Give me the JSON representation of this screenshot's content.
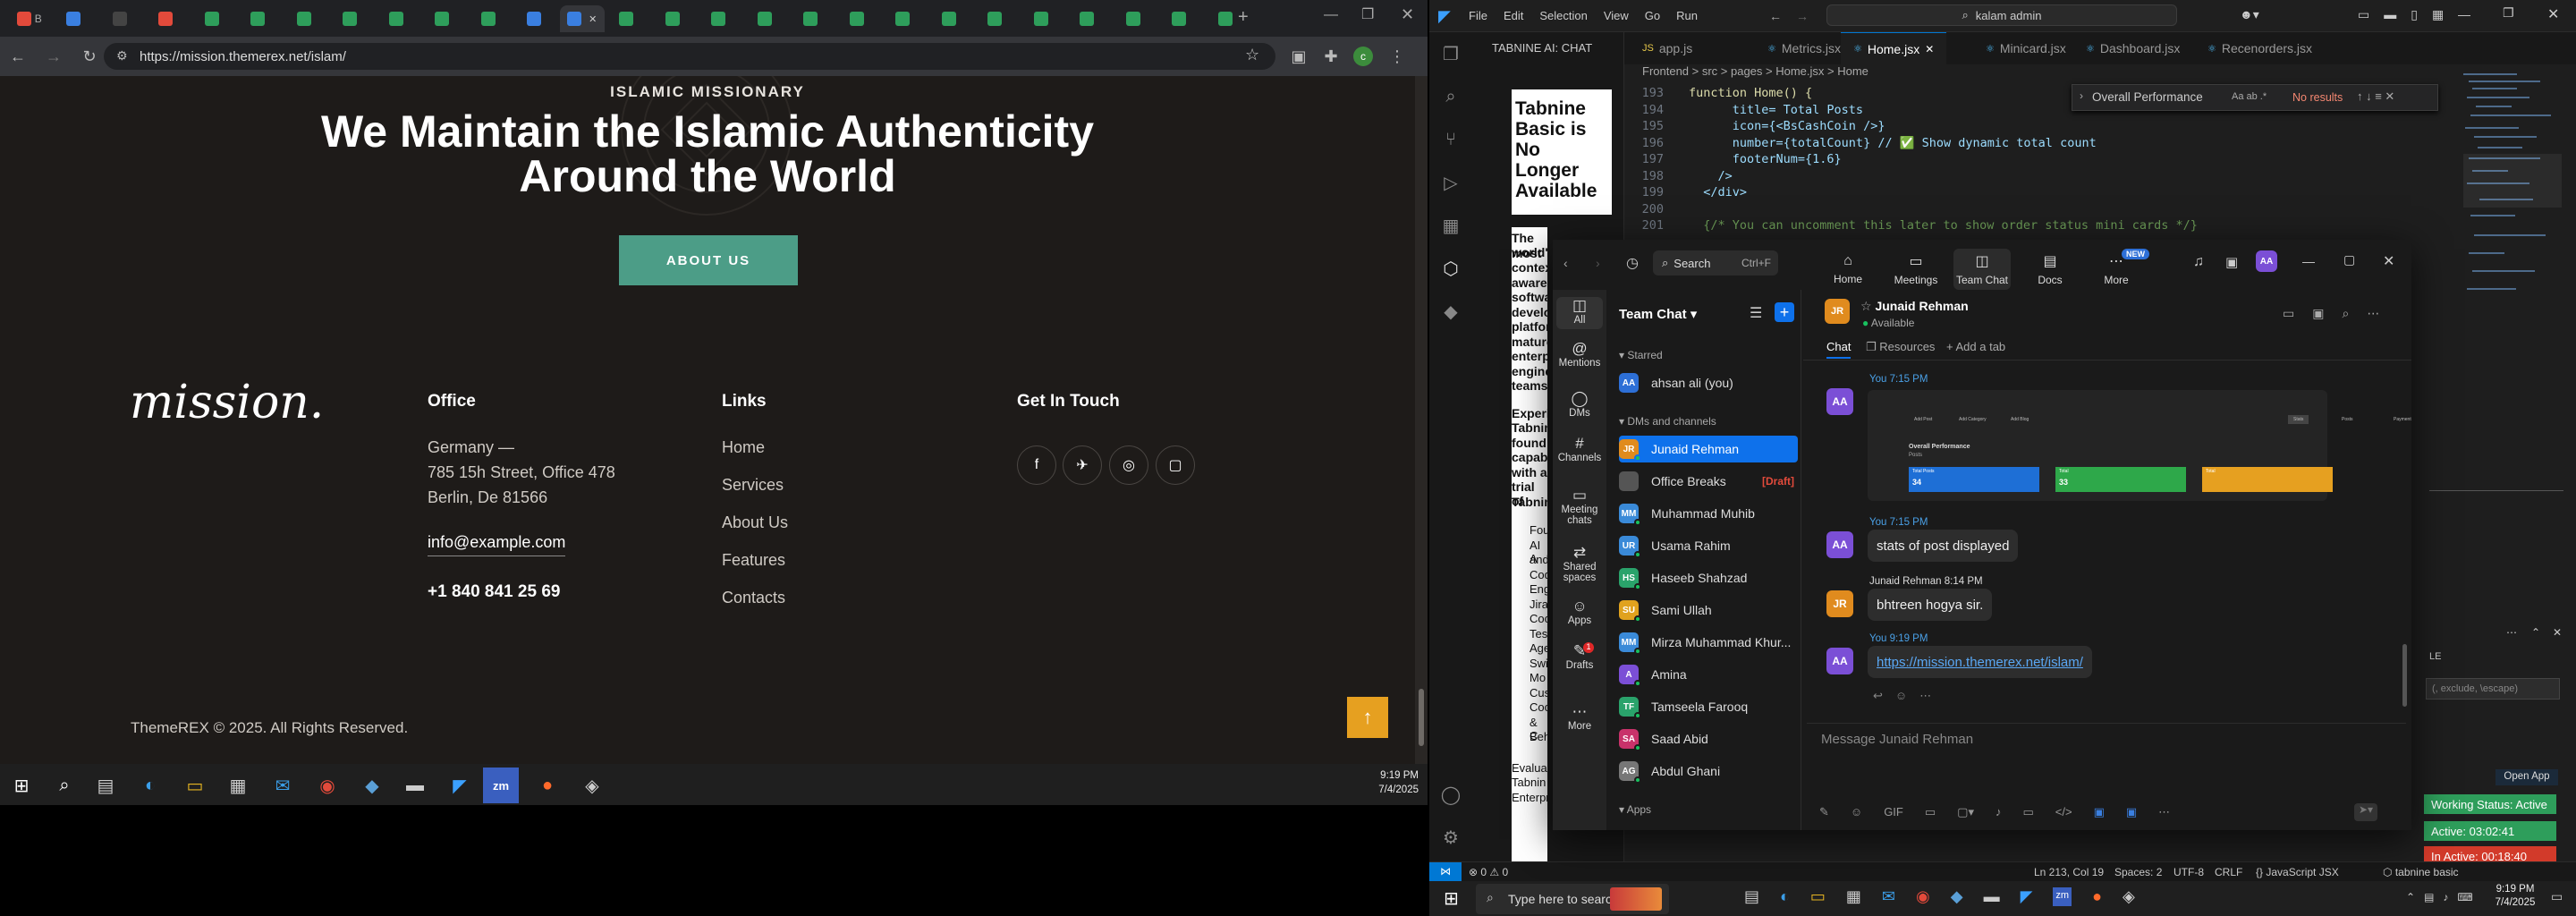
{
  "browser": {
    "tabs": [
      "B",
      "",
      "",
      "",
      "",
      "",
      "",
      "",
      "",
      "",
      "",
      "",
      "",
      "",
      "",
      "",
      "",
      "",
      "",
      "",
      "",
      "",
      "",
      "",
      "",
      "",
      ""
    ],
    "active_tab_label": "B",
    "url": "https://mission.themerex.net/islam/"
  },
  "site": {
    "kicker": "ISLAMIC MISSIONARY",
    "title_line1": "We Maintain the Islamic Authenticity",
    "title_line2": "Around the World",
    "about_button": "ABOUT US",
    "logo": "mission.",
    "office": {
      "heading": "Office",
      "line1": "Germany —",
      "line2": "785 15h Street, Office 478",
      "line3": "Berlin, De 81566",
      "email": "info@example.com",
      "phone": "+1 840 841 25 69"
    },
    "links": {
      "heading": "Links",
      "items": [
        "Home",
        "Services",
        "About Us",
        "Features",
        "Contacts"
      ]
    },
    "touch": {
      "heading": "Get In Touch"
    },
    "copyright": "ThemeREX © 2025. All Rights Reserved."
  },
  "left_taskbar": {
    "time": "9:19 PM",
    "date": "7/4/2025"
  },
  "vscode": {
    "menu": [
      "File",
      "Edit",
      "Selection",
      "View",
      "Go",
      "Run"
    ],
    "search": "kalam admin",
    "panel_title": "TABNINE AI: CHAT",
    "tabnine_title": "Tabnine Basic is No Longer Available",
    "tabnine_text": [
      "The world's",
      "most",
      "contex",
      "aware",
      "softwa",
      "develo",
      "platfor",
      "mature",
      "enterp",
      "engine",
      "teams."
    ],
    "tabnine_text2": [
      "Experi",
      "Tabnin",
      "found:",
      "capabi",
      "with a",
      "trial of",
      "Tabnin"
    ],
    "tabnine_bullets": [
      "Fou",
      "AI A",
      "and",
      "Cod",
      "Eng",
      "Jira",
      "Coc",
      "Tes",
      "Age",
      "Swi",
      "Mo",
      "Cus",
      "Coc",
      "& C",
      "Beh"
    ],
    "tabnine_footer": [
      "Evalua",
      "Tabnin",
      "Enterprise:"
    ],
    "tabs": [
      "app.js",
      "Metrics.jsx",
      "Home.jsx",
      "Minicard.jsx",
      "Dashboard.jsx",
      "Recenorders.jsx"
    ],
    "breadcrumb": "Frontend > src > pages > Home.jsx > Home",
    "code": [
      {
        "n": "193",
        "t": "function Home() {"
      },
      {
        "n": "194",
        "t": "      title= Total Posts"
      },
      {
        "n": "195",
        "t": "      icon={<BsCashCoin />}"
      },
      {
        "n": "196",
        "t": "      number={totalCount} // ✅ Show dynamic total count"
      },
      {
        "n": "197",
        "t": "      footerNum={1.6}"
      },
      {
        "n": "198",
        "t": "    />"
      },
      {
        "n": "199",
        "t": "  </div>"
      },
      {
        "n": "200",
        "t": ""
      },
      {
        "n": "201",
        "t": "  {/* You can uncomment this later to show order status mini cards */}"
      }
    ],
    "find_value": "Overall Performance",
    "find_result": "No results",
    "status": {
      "errors": "0",
      "warnings": "0",
      "position": "Ln 213, Col 19",
      "spaces": "Spaces: 2",
      "encoding": "UTF-8",
      "eol": "CRLF",
      "language": "JavaScript JSX",
      "tabnine": "tabnine basic"
    },
    "side_hint": "(, exclude, \\escape)",
    "open_app": "Open App",
    "timers": {
      "working": "Working Status: Active",
      "active": "Active: 03:02:41",
      "inactive": "In Active: 00:18:40"
    },
    "side_label": "LE"
  },
  "zoom": {
    "nav": [
      "Home",
      "Meetings",
      "Team Chat",
      "Docs",
      "More"
    ],
    "new_badge": "NEW",
    "search": "Search",
    "shortcut": "Ctrl+F",
    "rail": [
      "All",
      "Mentions",
      "DMs",
      "Channels",
      "Meeting chats",
      "Shared spaces",
      "Apps",
      "Drafts",
      "More"
    ],
    "drafts_badge": "1",
    "list_title": "Team Chat",
    "starred": "Starred",
    "dms_header": "DMs and channels",
    "apps_header": "Apps",
    "contacts": [
      {
        "initials": "AA",
        "name": "ahsan ali (you)",
        "color": "#2d6fd6"
      },
      {
        "initials": "JR",
        "name": "Junaid Rehman",
        "color": "#e08b1e"
      },
      {
        "initials": "",
        "name": "Office Breaks",
        "color": "#555555",
        "tag": "[Draft]"
      },
      {
        "initials": "MM",
        "name": "Muhammad Muhib",
        "color": "#3a8ad8"
      },
      {
        "initials": "UR",
        "name": "Usama Rahim",
        "color": "#3a8ad8"
      },
      {
        "initials": "HS",
        "name": "Haseeb Shahzad",
        "color": "#2aa36b"
      },
      {
        "initials": "SU",
        "name": "Sami Ullah",
        "color": "#e0a21e"
      },
      {
        "initials": "MM",
        "name": "Mirza Muhammad Khur...",
        "color": "#3a8ad8"
      },
      {
        "initials": "A",
        "name": "Amina",
        "color": "#7b4fd6"
      },
      {
        "initials": "TF",
        "name": "Tamseela Farooq",
        "color": "#2aa36b"
      },
      {
        "initials": "SA",
        "name": "Saad Abid",
        "color": "#c8326a"
      },
      {
        "initials": "AG",
        "name": "Abdul Ghani",
        "color": "#777777"
      }
    ],
    "chat": {
      "name": "Junaid Rehman",
      "status": "Available",
      "tabs": [
        "Chat",
        "Resources",
        "Add a tab"
      ],
      "msg1_time": "You 7:15 PM",
      "msg2_time": "You 7:15 PM",
      "msg2": "stats of post displayed",
      "msg3_time": "Junaid Rehman 8:14 PM",
      "msg3": "bhtreen hogya sir.",
      "msg4_time": "You 9:19 PM",
      "msg4": "https://mission.themerex.net/islam/",
      "input_placeholder": "Message Junaid Rehman",
      "shot": {
        "btns": [
          "Add Post",
          "Add Category",
          "Add Blog",
          "Stats",
          "Posts",
          "Payment"
        ],
        "heading": "Overall Performance",
        "sub": "Posts",
        "cards": [
          "Total Posts",
          "Total",
          "Total"
        ],
        "nums": [
          "34",
          "33",
          ""
        ]
      }
    }
  },
  "right_taskbar": {
    "search": "Type here to search",
    "time": "9:19 PM",
    "date": "7/4/2025"
  }
}
